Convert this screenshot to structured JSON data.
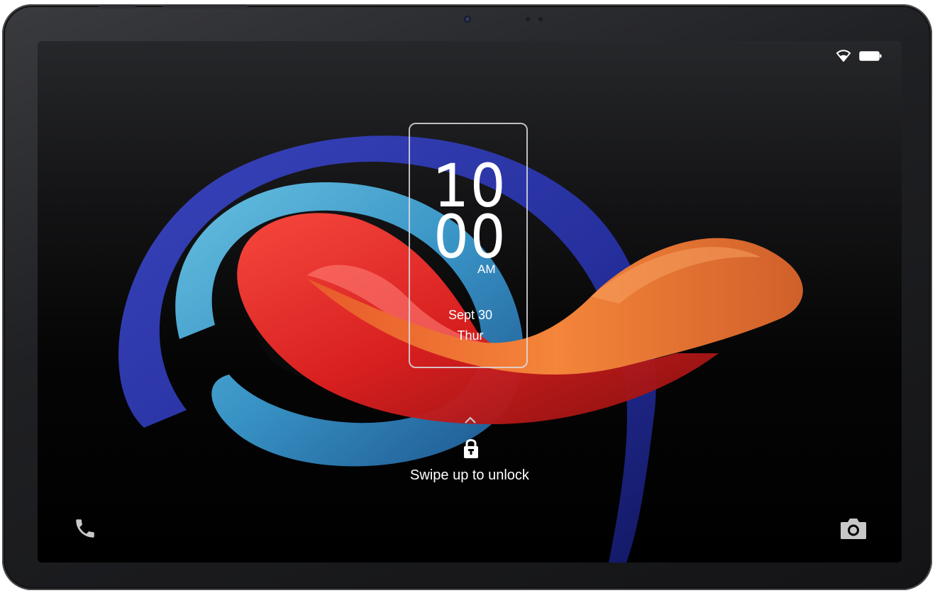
{
  "status_bar": {
    "wifi_icon": "wifi-icon",
    "battery_icon": "battery-full-icon"
  },
  "clock": {
    "hour": "10",
    "minute": "00",
    "ampm": "AM"
  },
  "date": {
    "day_month": "Sept 30",
    "weekday": "Thur"
  },
  "lock": {
    "chevron_icon": "chevron-up-icon",
    "lock_icon": "lock-icon",
    "hint": "Swipe up to unlock"
  },
  "shortcuts": {
    "left_icon": "phone-icon",
    "right_icon": "camera-icon"
  },
  "colors": {
    "text": "#ffffff",
    "swirl_blue": "#2a35a8",
    "swirl_cyan": "#3fa8d8",
    "swirl_red": "#e82a22",
    "swirl_orange": "#f07a2e"
  }
}
